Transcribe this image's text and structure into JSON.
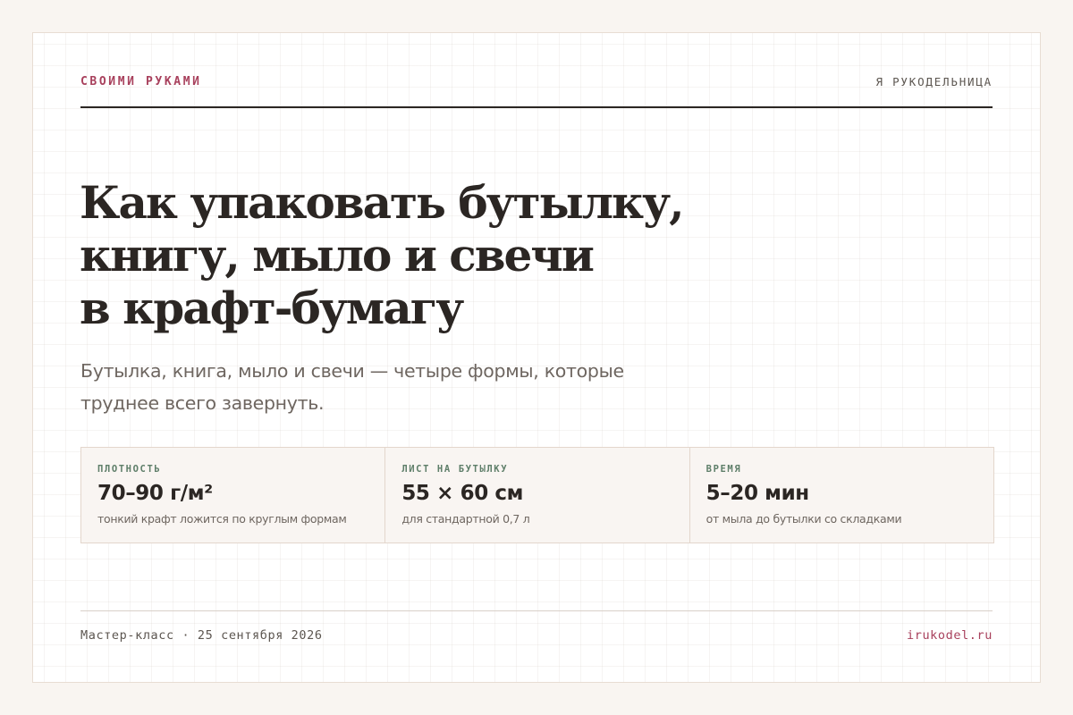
{
  "header": {
    "brand": "СВОИМИ РУКАМИ",
    "author": "Я РУКОДЕЛЬНИЦА"
  },
  "article": {
    "title_lines": [
      "Как упаковать бутылку,",
      "книгу, мыло и свечи",
      "в крафт-бумагу"
    ],
    "subtitle": "Бутылка, книга, мыло и свечи — четыре формы, которые труднее всего завернуть."
  },
  "stats": [
    {
      "label": "ПЛОТНОСТЬ",
      "value": "70–90 г/м²",
      "note": "тонкий крафт ложится по круглым формам"
    },
    {
      "label": "ЛИСТ НА БУТЫЛКУ",
      "value": "55 × 60 см",
      "note": "для стандартной 0,7 л"
    },
    {
      "label": "ВРЕМЯ",
      "value": "5–20 мин",
      "note": "от мыла до бутылки со складками"
    }
  ],
  "footer": {
    "event": "Мастер-класс · 25 сентября 2026",
    "site": "irukodel.ru"
  },
  "colors": {
    "accent": "#a8405c",
    "label_green": "#5e7e69",
    "text_dark": "#2b2623",
    "text_muted": "#6e6660",
    "page_bg": "#f9f5f1"
  }
}
